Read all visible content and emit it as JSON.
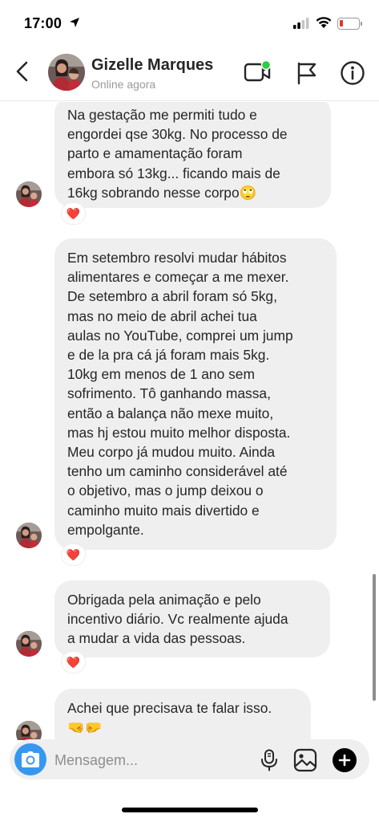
{
  "status_bar": {
    "time": "17:00"
  },
  "header": {
    "contact_name": "Gizelle Marques",
    "status": "Online agora"
  },
  "messages": [
    {
      "text": "Na gestação me permiti tudo e\nengordei qse 30kg. No processo de\nparto e amamentação foram\nembora só 13kg... ficando mais de\n16kg sobrando nesse corpo🙄",
      "reaction": "❤️"
    },
    {
      "text": "Em setembro resolvi mudar hábitos\nalimentares e começar a me mexer.\nDe setembro a abril foram só 5kg,\nmas no meio de abril achei tua\naulas no YouTube, comprei um jump\ne de la pra cá já foram mais 5kg.\n10kg em menos de 1 ano sem\nsofrimento. Tô ganhando massa,\nentão a balança não mexe muito,\nmas hj estou muito melhor disposta.\nMeu corpo já mudou muito. Ainda\ntenho um caminho considerável até\no objetivo, mas o jump deixou o\ncaminho muito mais divertido e\nempolgante.",
      "reaction": "❤️"
    },
    {
      "text": "Obrigada pela animação e pelo\nincentivo diário. Vc realmente ajuda\na mudar a vida das pessoas.",
      "reaction": "❤️"
    },
    {
      "text": "Achei que precisava te falar isso.\n🤜🤛"
    }
  ],
  "composer": {
    "placeholder": "Mensagem..."
  },
  "colors": {
    "bubble": "#efefef",
    "camera_button": "#3797f0",
    "online_dot": "#2ecc40",
    "heart": "#e0303a"
  },
  "icons": [
    "back-arrow-icon",
    "video-call-icon",
    "flag-icon",
    "info-icon",
    "camera-icon",
    "microphone-icon",
    "gallery-icon",
    "plus-icon",
    "heart-icon"
  ]
}
